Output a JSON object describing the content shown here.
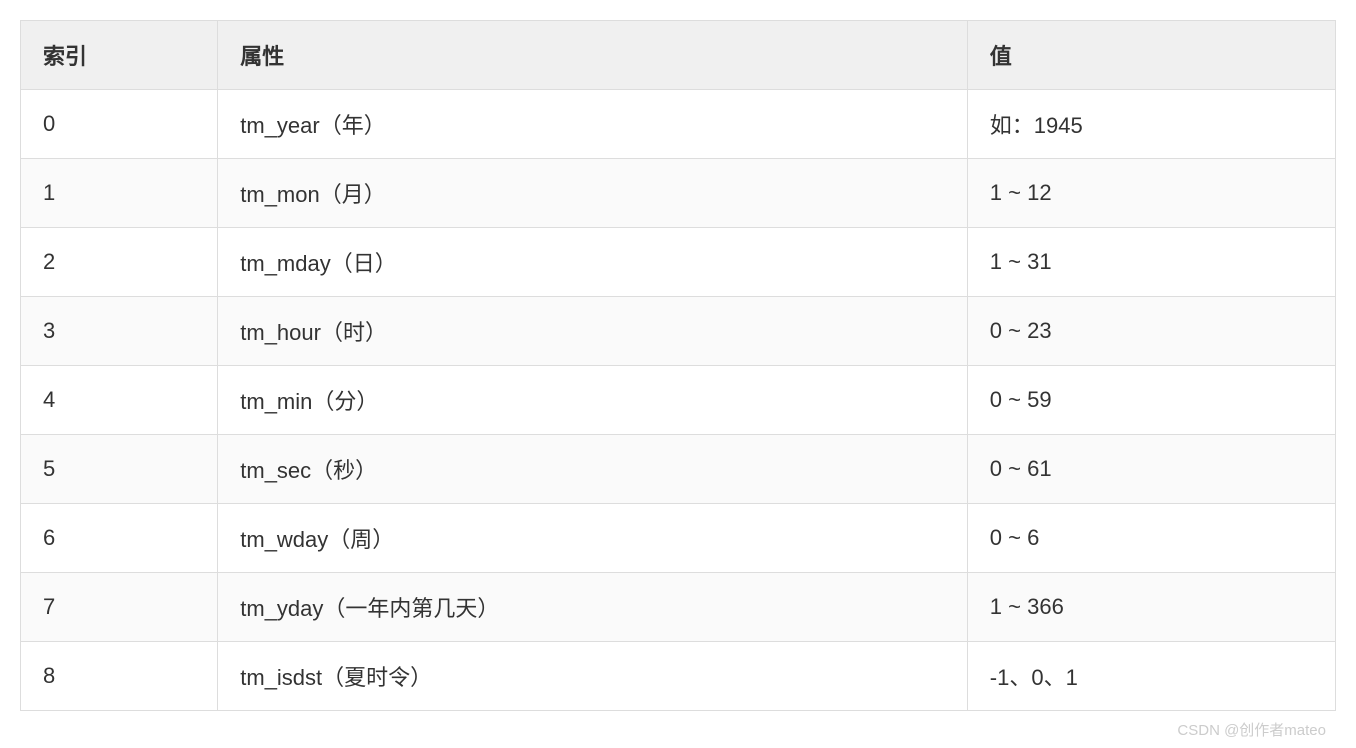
{
  "table": {
    "headers": {
      "index": "索引",
      "attribute": "属性",
      "value": "值"
    },
    "rows": [
      {
        "index": "0",
        "attribute": "tm_year（年）",
        "value": "如：1945"
      },
      {
        "index": "1",
        "attribute": "tm_mon（月）",
        "value": "1 ~ 12"
      },
      {
        "index": "2",
        "attribute": "tm_mday（日）",
        "value": "1 ~ 31"
      },
      {
        "index": "3",
        "attribute": "tm_hour（时）",
        "value": "0 ~ 23"
      },
      {
        "index": "4",
        "attribute": "tm_min（分）",
        "value": "0 ~ 59"
      },
      {
        "index": "5",
        "attribute": "tm_sec（秒）",
        "value": "0 ~ 61"
      },
      {
        "index": "6",
        "attribute": "tm_wday（周）",
        "value": "0 ~ 6"
      },
      {
        "index": "7",
        "attribute": "tm_yday（一年内第几天）",
        "value": "1 ~ 366"
      },
      {
        "index": "8",
        "attribute": "tm_isdst（夏时令）",
        "value": "-1、0、1"
      }
    ]
  },
  "watermark": "CSDN @创作者mateo"
}
